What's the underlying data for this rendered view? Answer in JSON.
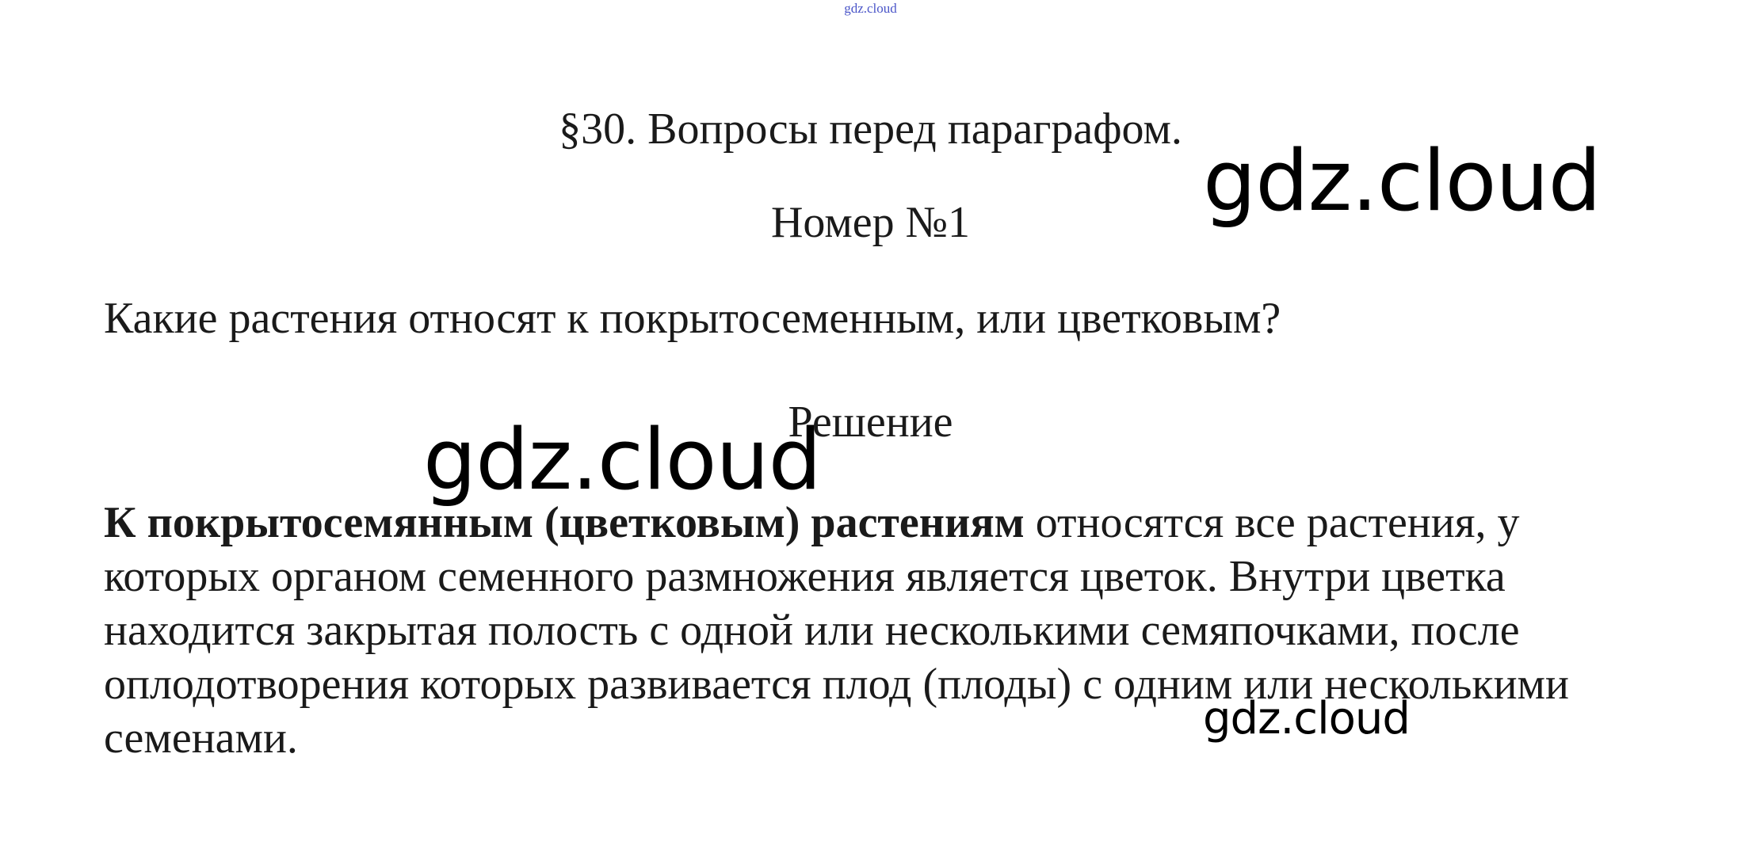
{
  "watermarks": {
    "top": "gdz.cloud",
    "large_right": "gdz.cloud",
    "large_left": "gdz.cloud",
    "small_bottom": "gdz.cloud"
  },
  "document": {
    "section_title": "§30. Вопросы перед параграфом.",
    "task_number": "Номер №1",
    "question": "Какие растения относят к покрытосеменным, или цветковым?",
    "solution_label": "Решение",
    "answer": {
      "term": "К покрытосемянным (цветковым) растениям",
      "rest": " относятся все растения, у которых органом семенного размножения является цветок. Внутри цветка находится закрытая полость с одной или несколькими семяпочками, после оплодотворения которых развивается плод (плоды) с одним или несколькими семенами."
    }
  },
  "colors": {
    "text": "#1a1a1a",
    "watermark_top": "#4a55c8",
    "watermark": "#000000"
  }
}
